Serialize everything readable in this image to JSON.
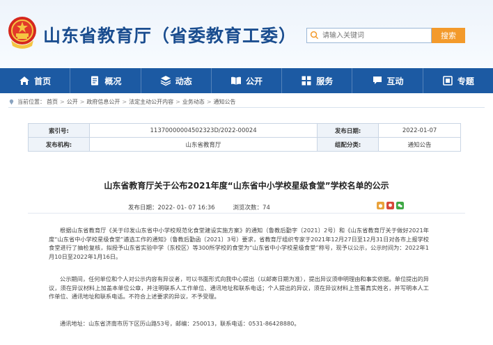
{
  "header": {
    "site_title": "山东省教育厅（省委教育工委）",
    "search_placeholder": "请输入关键词",
    "search_button": "搜索"
  },
  "nav": [
    {
      "label": "首页",
      "icon": "home-icon"
    },
    {
      "label": "概况",
      "icon": "document-icon"
    },
    {
      "label": "动态",
      "icon": "stack-icon"
    },
    {
      "label": "公开",
      "icon": "open-book-icon"
    },
    {
      "label": "服务",
      "icon": "service-icon"
    },
    {
      "label": "互动",
      "icon": "chat-icon"
    },
    {
      "label": "专题",
      "icon": "topics-icon"
    }
  ],
  "breadcrumb": {
    "prefix": "当前位置：",
    "items": [
      "首页",
      "公开",
      "政府信息公开",
      "法定主动公开内容",
      "业务动态",
      "通知公告"
    ]
  },
  "info": {
    "index_label": "索引号:",
    "index_value": "11370000004502323D/2022-00024",
    "date_label": "发布日期:",
    "date_value": "2022-01-07",
    "org_label": "发布机构:",
    "org_value": "山东省教育厅",
    "category_label": "组配分类:",
    "category_value": "通知公告"
  },
  "article": {
    "title": "山东省教育厅关于公布2021年度“山东省中小学校星级食堂”学校名单的公示",
    "publish_label": "发布日期：",
    "publish_value": "2022- 01- 07 16:36",
    "views_label": "浏览次数：",
    "views_value": "74",
    "p1": "根据山东省教育厅《关于印发山东省中小学校规范化食堂建设实施方案》的通知（鲁教后勤字〔2021〕2号）和《山东省教育厅关于做好2021年度“山东省中小学校星级食堂”遴选工作的通知》（鲁教后勤函〔2021〕3号）要求，省教育厅组织专家于2021年12月27日至12月31日对各市上报学校食堂进行了抽检复核，拟授予山东省实验中学（东校区）等300所学校的食堂为“山东省中小学校星级食堂”称号，现予以公示，公示时间为：2022年1月10日至2022年1月16日。",
    "p2": "公示期间，任何单位和个人对公示内容有异议者，可以书面形式向我中心提出（以邮寄日期为准），提出异议须申明理由和事实依据。单位提出的异议，须在异议材料上加盖本单位公章，并注明联系人工作单位、通讯地址和联系电话；个人提出的异议，须在异议材料上签署真实姓名，并写明本人工作单位、通讯地址和联系电话。不符合上述要求的异议，不予受理。",
    "p3": "通讯地址：山东省济南市历下区历山路53号，邮编：250013，联系电话：0531-86428880。"
  },
  "colors": {
    "nav_bg": "#1c5aa3",
    "title_blue": "#1a4d8f",
    "search_orange": "#f39a2b"
  }
}
